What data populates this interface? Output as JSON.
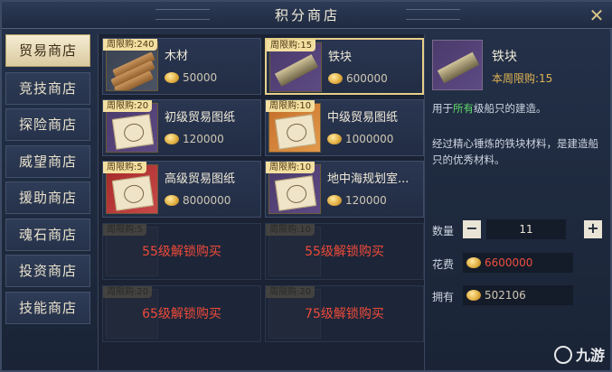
{
  "window": {
    "title": "积分商店"
  },
  "sidebar": {
    "items": [
      {
        "label": "贸易商店",
        "active": true
      },
      {
        "label": "竞技商店"
      },
      {
        "label": "探险商店"
      },
      {
        "label": "威望商店"
      },
      {
        "label": "援助商店"
      },
      {
        "label": "魂石商店"
      },
      {
        "label": "投资商店"
      },
      {
        "label": "技能商店"
      }
    ]
  },
  "shop": {
    "items": [
      {
        "limit": "周限购:240",
        "name": "木材",
        "price": "50000",
        "rarity": "grey"
      },
      {
        "limit": "周限购:15",
        "name": "铁块",
        "price": "600000",
        "rarity": "purple",
        "selected": true
      },
      {
        "limit": "周限购:20",
        "name": "初级贸易图纸",
        "price": "120000",
        "rarity": "purple"
      },
      {
        "limit": "周限购:10",
        "name": "中级贸易图纸",
        "price": "1000000",
        "rarity": "orange"
      },
      {
        "limit": "周限购:5",
        "name": "高级贸易图纸",
        "price": "8000000",
        "rarity": "red"
      },
      {
        "limit": "周限购:10",
        "name": "地中海规划室...",
        "price": "120000",
        "rarity": "purple"
      },
      {
        "limit": "周限购:5",
        "locked_text": "55级解锁购买"
      },
      {
        "limit": "周限购:10",
        "locked_text": "55级解锁购买"
      },
      {
        "limit": "周限购:20",
        "locked_text": "65级解锁购买"
      },
      {
        "limit": "周限购:20",
        "locked_text": "75级解锁购买"
      }
    ]
  },
  "detail": {
    "name": "铁块",
    "limit_text": "本周限购:15",
    "desc1_prefix": "用于",
    "desc1_highlight": "所有",
    "desc1_suffix": "级船只的建造。",
    "desc2": "经过精心锤炼的铁块材料，是建造船只的优秀材料。",
    "quantity_label": "数量",
    "quantity": "11",
    "minus_label": "−",
    "plus_label": "+",
    "cost_label": "花费",
    "cost": "6600000",
    "own_label": "拥有",
    "own": "502106"
  },
  "watermark": {
    "text": "九游"
  },
  "colors": {
    "accent": "#e7cf8a",
    "locked": "#ee4a3a",
    "highlight": "#62d96a",
    "limit": "#e0b352"
  }
}
